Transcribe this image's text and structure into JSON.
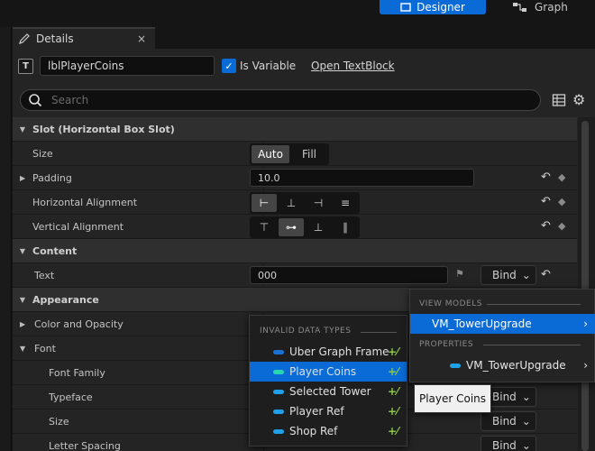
{
  "toolbar": {
    "designer_label": "Designer",
    "graph_label": "Graph"
  },
  "tab": {
    "title": "Details",
    "close": "×"
  },
  "header": {
    "widget_type_icon": "T",
    "widget_name": "lblPlayerCoins",
    "is_variable_label": "Is Variable",
    "is_variable_checked": true,
    "open_link": "Open TextBlock"
  },
  "search": {
    "placeholder": "Search"
  },
  "sections": {
    "slot": {
      "title": "Slot (Horizontal Box Slot)",
      "size_label": "Size",
      "size_options": [
        "Auto",
        "Fill"
      ],
      "size_selected": "Auto",
      "padding_label": "Padding",
      "padding_value": "10.0",
      "halign_label": "Horizontal Alignment",
      "valign_label": "Vertical Alignment"
    },
    "content": {
      "title": "Content",
      "text_label": "Text",
      "text_value": "000",
      "bind_label": "Bind"
    },
    "appearance": {
      "title": "Appearance",
      "color_label": "Color and Opacity",
      "font_label": "Font",
      "font_family_label": "Font Family",
      "typeface_label": "Typeface",
      "size_label": "Size",
      "letter_spacing_label": "Letter Spacing"
    }
  },
  "data_type_menu": {
    "header": "INVALID DATA TYPES",
    "items": [
      {
        "label": "Uber Graph Frame",
        "color": "#1a73d4"
      },
      {
        "label": "Player Coins",
        "color": "#2ad6b0"
      },
      {
        "label": "Selected Tower",
        "color": "#1fa0e8"
      },
      {
        "label": "Player Ref",
        "color": "#1fa0e8"
      },
      {
        "label": "Shop Ref",
        "color": "#1fa0e8"
      }
    ],
    "selected": "Player Coins"
  },
  "view_model_menu": {
    "view_models_header": "VIEW MODELS",
    "view_model": "VM_TowerUpgrade",
    "properties_header": "PROPERTIES",
    "property": "VM_TowerUpgrade"
  },
  "tooltip": "Player Coins",
  "colors": {
    "accent": "#0b6bd6",
    "panel": "#242424"
  }
}
